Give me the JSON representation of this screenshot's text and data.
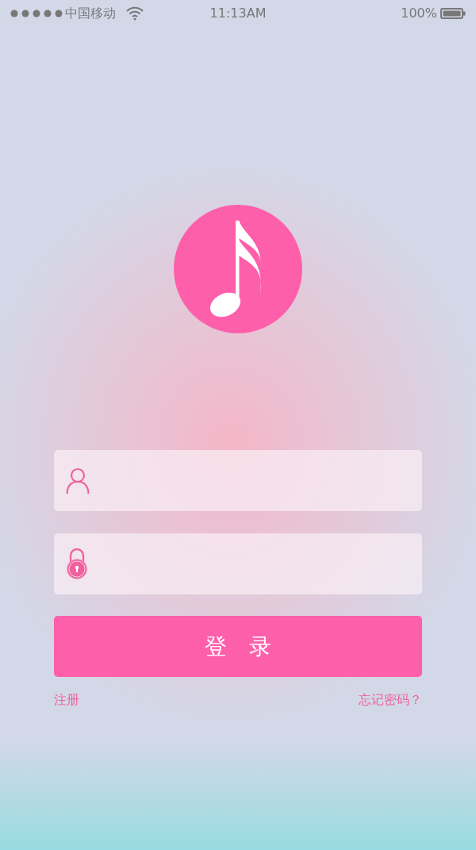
{
  "status_bar": {
    "carrier": "中国移动",
    "time": "11:13AM",
    "battery": "100%"
  },
  "fields": [
    {
      "kind": "user"
    },
    {
      "kind": "lock"
    }
  ],
  "login_button": {
    "label": "登　录"
  },
  "links": [
    {
      "label": "注册"
    },
    {
      "label": "忘记密码？"
    }
  ]
}
